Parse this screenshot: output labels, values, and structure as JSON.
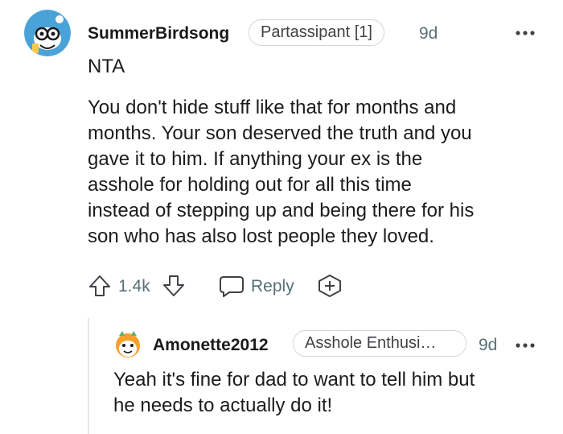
{
  "comment": {
    "username": "SummerBirdsong",
    "flair": "Partassipant [1]",
    "time": "9d",
    "title_text": "NTA",
    "body_lines": [
      "You don't hide stuff like that for months and",
      "months. Your son deserved the truth and you",
      "gave it to him. If anything your ex is the",
      "asshole for holding out for all this time",
      "instead of stepping up and being there for his",
      "son who has also lost people they loved."
    ],
    "vote_count": "1.4k",
    "reply_label": "Reply",
    "more_icon": "more-dots-icon"
  },
  "reply": {
    "username": "Amonette2012",
    "flair": "Asshole Enthusi…",
    "time": "9d",
    "body_lines": [
      "Yeah it's fine for dad to want to tell him but",
      "he needs to actually do it!"
    ]
  },
  "colors": {
    "muted": "#576f76",
    "text": "#1c1c1c",
    "avatar_bg": "#4aa3d8",
    "reply_avatar_bg": "#f6a12f"
  }
}
